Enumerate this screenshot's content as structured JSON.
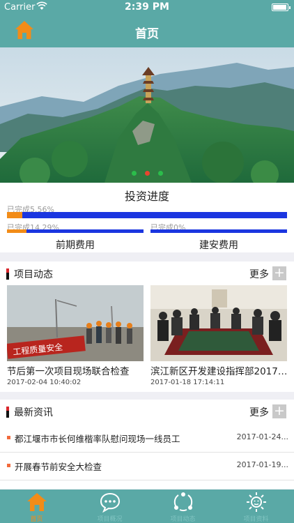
{
  "status_bar": {
    "carrier": "Carrier",
    "time": "2:39 PM"
  },
  "nav": {
    "title": "首页",
    "home_icon": "home-icon"
  },
  "banner": {
    "slides": 3,
    "active_slide": 2
  },
  "investment": {
    "title": "投资进度",
    "overall": {
      "label": "已完成5.56%",
      "progress": 0.0556
    },
    "items": [
      {
        "label": "已完成14.29%",
        "progress": 0.1429,
        "caption": "前期费用"
      },
      {
        "label": "已完成0%",
        "progress": 0,
        "caption": "建安费用"
      }
    ]
  },
  "project_news": {
    "title": "项目动态",
    "more": "更多",
    "items": [
      {
        "title": "节后第一次项目现场联合检查",
        "date": "2017-02-04  10:40:02"
      },
      {
        "title": "滨江新区开发建设指挥部2017年…",
        "date": "2017-01-18  17:14:11"
      }
    ]
  },
  "latest_info": {
    "title": "最新资讯",
    "more": "更多",
    "items": [
      {
        "title": "都江堰市市长何维楷率队慰问现场一线员工",
        "date": "2017-01-24..."
      },
      {
        "title": "开展春节前安全大检查",
        "date": "2017-01-19..."
      }
    ]
  },
  "tabbar": {
    "tabs": [
      {
        "label": "首页",
        "icon": "home-icon",
        "active": true
      },
      {
        "label": "项目概况",
        "icon": "chat-icon",
        "active": false
      },
      {
        "label": "项目动态",
        "icon": "share-icon",
        "active": false
      },
      {
        "label": "项目资料",
        "icon": "sun-icon",
        "active": false
      }
    ]
  },
  "colors": {
    "header": "#5aa9a6",
    "accent": "#f28c18",
    "progress_track": "#1b36e0"
  }
}
